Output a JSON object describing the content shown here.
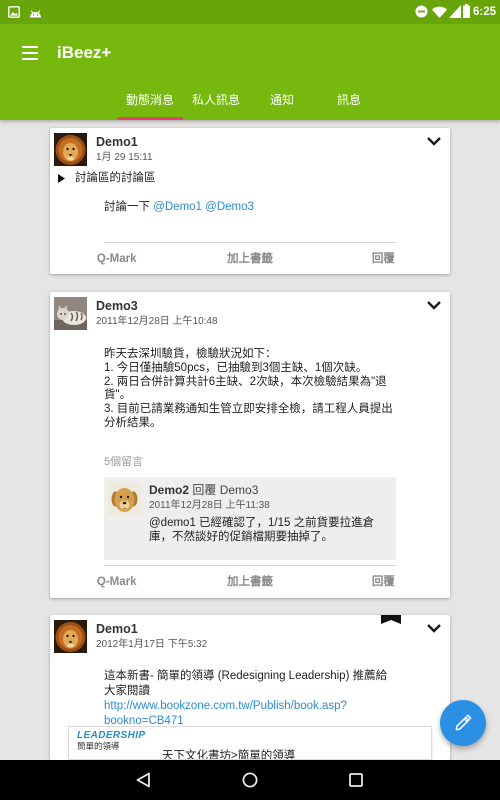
{
  "theme": {
    "primary": "#76b80e",
    "status_bar": "#67a50b",
    "accent": "#e8416f",
    "fab": "#2b90e3",
    "link": "#2e8bd1"
  },
  "status_bar": {
    "notification_icons": [
      "image-icon",
      "android-icon"
    ],
    "system_icons": [
      "do-not-disturb-icon",
      "wifi-icon",
      "cellular-signal-icon",
      "battery-icon"
    ],
    "time": "6:25"
  },
  "app_bar": {
    "menu_icon": "hamburger-menu-icon",
    "title": "iBeez+"
  },
  "tabs": [
    {
      "label": "動態消息",
      "selected": true
    },
    {
      "label": "私人訊息",
      "selected": false
    },
    {
      "label": "通知",
      "selected": false
    },
    {
      "label": "訊息",
      "selected": false
    }
  ],
  "post_actions": {
    "qmark": "Q-Mark",
    "bookmark": "加上書籤",
    "reply": "回覆"
  },
  "posts": [
    {
      "author": "Demo1",
      "timestamp": "1月 29 15:11",
      "topic": "討論區的討論區",
      "body_text": "討論一下",
      "mentions": [
        "@Demo1",
        "@Demo3"
      ]
    },
    {
      "author": "Demo3",
      "timestamp": "2011年12月28日 上午10:48",
      "body_lines": [
        "昨天去深圳驗貨，檢驗狀況如下：",
        "1. 今日僅抽驗50pcs，已抽驗到3個主缺、1個次缺。",
        "2. 兩日合併計算共計6主缺、2次缺，本次檢驗結果為\"退貨\"。",
        "3. 目前已請業務通知生管立即安排全檢，請工程人員提出分析結果。"
      ],
      "comment_count": "5個留言",
      "latest_comment": {
        "author": "Demo2",
        "reply_to": "回覆 Demo3",
        "timestamp": "2011年12月28日 上午11:38",
        "text": "@demo1 已經確認了，1/15 之前貨要拉進倉庫，不然談好的促銷檔期要抽掉了。"
      }
    },
    {
      "author": "Demo1",
      "timestamp": "2012年1月17日 下午5:32",
      "bookmarked": true,
      "body_text": "這本新書- 簡單的領導 (Redesigning Leadership) 推薦給大家閱讀",
      "link": "http://www.bookzone.com.tw/Publish/book.asp?bookno=CB471",
      "link_preview": {
        "logo_text": "LEADERSHIP",
        "logo_subtitle": "簡單的領導",
        "title": "天下文化書坊>簡單的領導"
      }
    }
  ],
  "fab": {
    "icon": "pencil-icon"
  },
  "nav_bar": {
    "icons": [
      "back-icon",
      "home-icon",
      "recents-icon"
    ]
  }
}
